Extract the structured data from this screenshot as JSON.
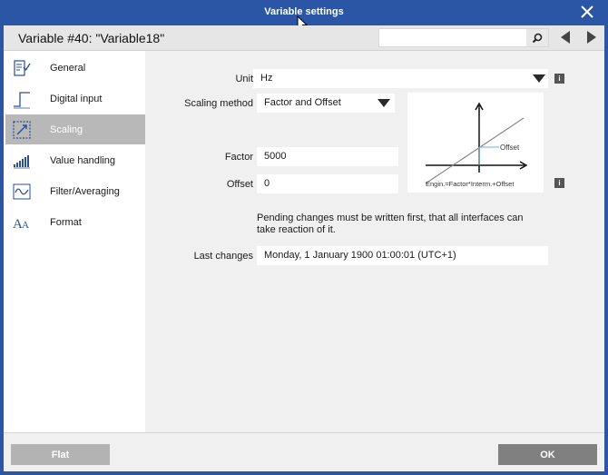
{
  "window": {
    "title": "Variable settings"
  },
  "header": {
    "variable_title": "Variable #40: \"Variable18\"",
    "search_value": ""
  },
  "sidebar": {
    "items": [
      {
        "label": "General",
        "icon": "clipboard-check-icon",
        "active": false
      },
      {
        "label": "Digital input",
        "icon": "digital-input-icon",
        "active": false
      },
      {
        "label": "Scaling",
        "icon": "scaling-icon",
        "active": true
      },
      {
        "label": "Value handling",
        "icon": "bar-graph-icon",
        "active": false
      },
      {
        "label": "Filter/Averaging",
        "icon": "filter-wave-icon",
        "active": false
      },
      {
        "label": "Format",
        "icon": "font-format-icon",
        "active": false
      }
    ]
  },
  "form": {
    "unit_label": "Unit",
    "unit_value": "Hz",
    "scaling_method_label": "Scaling method",
    "scaling_method_value": "Factor and Offset",
    "factor_label": "Factor",
    "factor_value": "5000",
    "offset_label": "Offset",
    "offset_value": "0",
    "pending_note": "Pending changes must be written first, that all interfaces can take reaction of it.",
    "last_changes_label": "Last changes",
    "last_changes_value": "Monday, 1 January 1900   01:00:01 (UTC+1)",
    "info_glyph": "i"
  },
  "diagram": {
    "offset_label": "Offset",
    "formula": "Engin.=Factor*Interm.+Offset"
  },
  "footer": {
    "flat_label": "Flat",
    "ok_label": "OK"
  },
  "colors": {
    "titlebar": "#2b56a6",
    "active_item": "#b8b8b8",
    "ok_button": "#808080",
    "flat_button": "#b3b3b3"
  }
}
